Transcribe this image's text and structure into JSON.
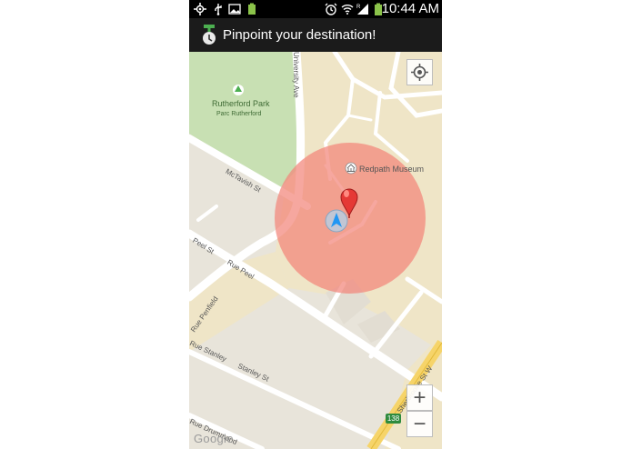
{
  "status_bar": {
    "time": "10:44 AM",
    "icons": [
      "gps-icon",
      "usb-icon",
      "gallery-icon",
      "battery-small-icon",
      "alarm-icon",
      "wifi-icon",
      "signal-icon",
      "battery-icon"
    ]
  },
  "action_bar": {
    "title": "Pinpoint your destination!",
    "app_icon": "pin-app-icon"
  },
  "map": {
    "labels": {
      "park_name": "Rutherford Park",
      "park_name_fr": "Parc Rutherford",
      "museum": "Redpath Museum",
      "street_mctavish": "McTavish St",
      "street_peel": "Peel St",
      "street_rue_peel": "Rue Peel",
      "street_penfield": "Rue Penfield",
      "street_rue_stanley": "Rue Stanley",
      "street_stanley": "Stanley St",
      "street_drummond": "Rue Drummond",
      "street_univ": "University Ave",
      "street_sherbrooke": "Sherbrooke St W",
      "route_number": "138"
    },
    "zoom_in_label": "+",
    "zoom_out_label": "−",
    "logo": "Google",
    "colors": {
      "park": "#c8e0b3",
      "land": "#e8e4da",
      "campus": "#efe4c9",
      "road": "#ffffff",
      "highway": "#f6d469",
      "accuracy_circle": "#f2857a",
      "pin": "#e53935"
    }
  }
}
